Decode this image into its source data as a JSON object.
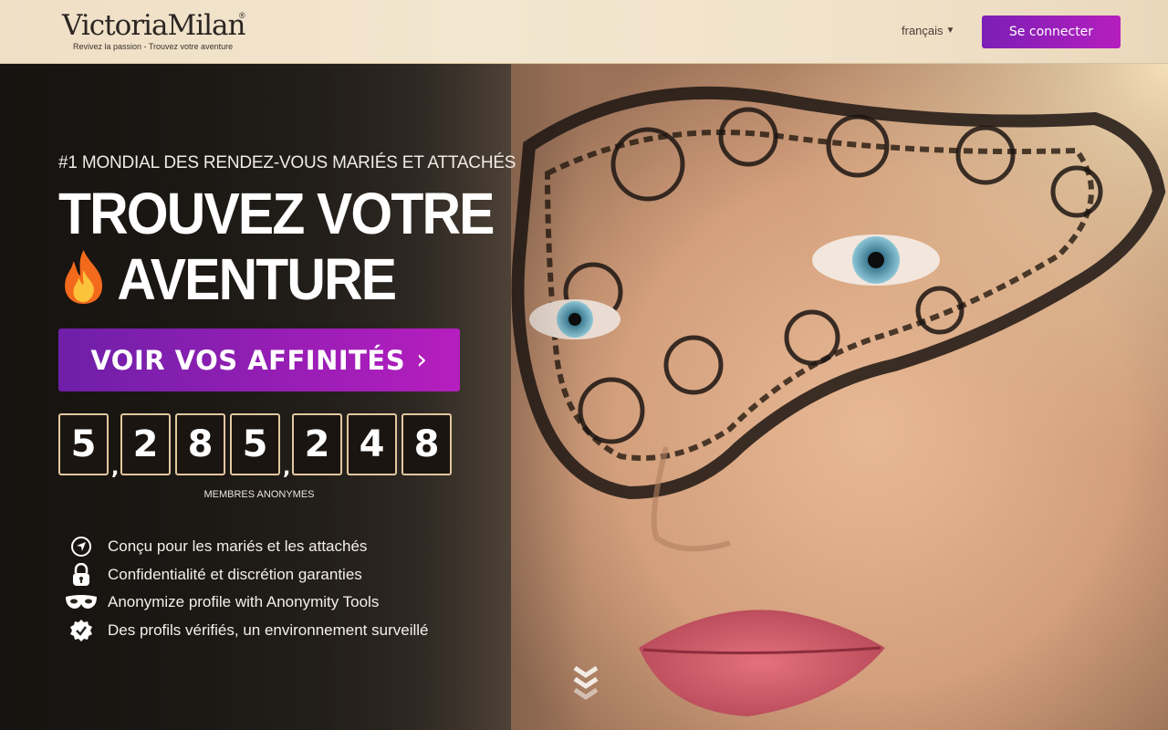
{
  "header": {
    "logo_text": "VictoriaMilan",
    "logo_reg": "®",
    "logo_tagline": "Revivez la passion - Trouvez votre aventure",
    "language": "français",
    "login_label": "Se connecter"
  },
  "hero": {
    "kicker": "#1 MONDIAL DES RENDEZ-VOUS MARIÉS ET ATTACHÉS",
    "headline_line1": "TROUVEZ VOTRE",
    "headline_line2": "AVENTURE",
    "cta_label": "VOIR VOS AFFINITÉS",
    "cta_icon": "chevron-right-icon",
    "counter_digits": [
      "5",
      "2",
      "8",
      "5",
      "2",
      "4",
      "8"
    ],
    "counter_separator": ",",
    "counter_label": "MEMBRES ANONYMES",
    "features": [
      {
        "icon": "location-icon",
        "text": "Conçu pour les mariés et les attachés"
      },
      {
        "icon": "lock-icon",
        "text": "Confidentialité et discrétion garanties"
      },
      {
        "icon": "mask-icon",
        "text": "Anonymize profile with Anonymity Tools"
      },
      {
        "icon": "verified-badge-icon",
        "text": "Des profils vérifiés, un environnement surveillé"
      }
    ],
    "scroll_icon": "double-chevron-down-icon"
  },
  "colors": {
    "brand_purple": "#7b1fb5",
    "brand_magenta": "#b51fbe",
    "header_bg": "#f1e3cb",
    "digit_border": "#e2c79e"
  }
}
